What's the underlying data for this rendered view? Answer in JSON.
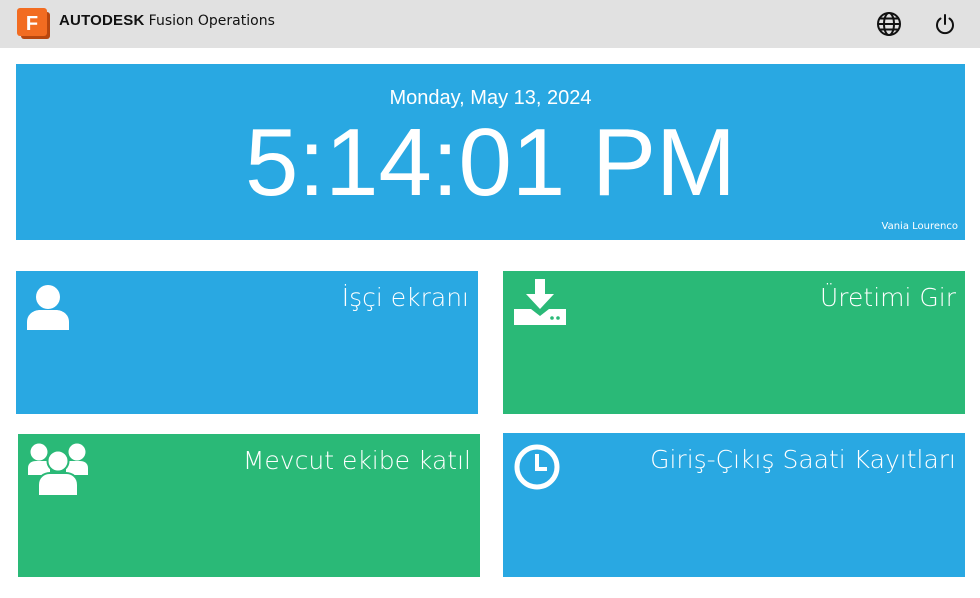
{
  "header": {
    "brand_bold": "AUTODESK",
    "brand_product": "Fusion Operations",
    "logo_letter": "F",
    "icons": [
      "globe-icon",
      "power-icon"
    ]
  },
  "clock": {
    "date": "Monday, May 13, 2024",
    "time": "5:14:01 PM",
    "user": "Vania Lourenco"
  },
  "tiles": [
    {
      "label": "İşçi ekranı",
      "icon": "user-icon",
      "color": "#29a8e2"
    },
    {
      "label": "Üretimi Gir",
      "icon": "download-tray-icon",
      "color": "#2ab977"
    },
    {
      "label": "Mevcut ekibe katıl",
      "icon": "users-group-icon",
      "color": "#2ab977"
    },
    {
      "label": "Giriş-Çıkış Saati Kayıtları",
      "icon": "clock-icon",
      "color": "#29a8e2"
    }
  ],
  "colors": {
    "topbar": "#e1e1e1",
    "blue": "#29a8e2",
    "green": "#2ab977",
    "logo_orange": "#f26c21"
  }
}
